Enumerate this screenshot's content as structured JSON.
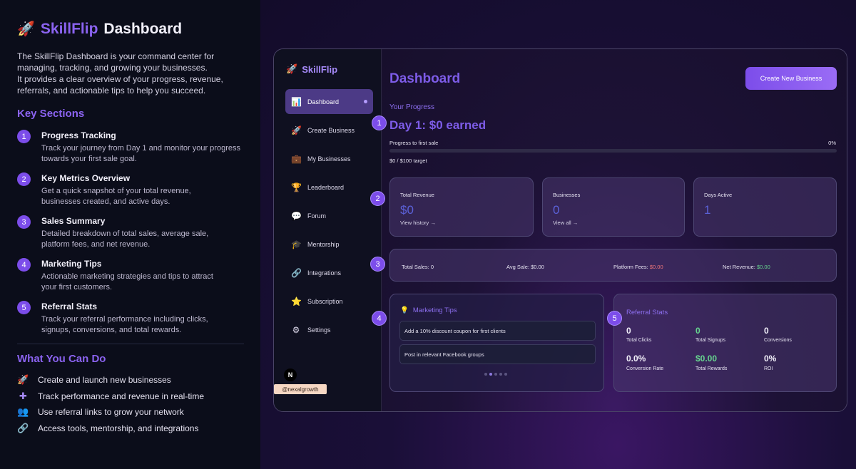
{
  "left": {
    "icon": "rocket-icon",
    "brand_accent": "SkillFlip",
    "brand_rest": "Dashboard",
    "intro_lines": [
      "The SkillFlip Dashboard is your command center for",
      "managing, tracking, and growing your businesses.",
      "It provides a clear overview of your progress, revenue,",
      "referrals, and actionable tips to help you succeed."
    ],
    "key_sections_heading": "Key Sections",
    "key_sections": [
      {
        "num": "1",
        "title": "Progress Tracking",
        "desc1": "Track your journey from Day 1 and monitor your progress",
        "desc2": "towards your first sale goal."
      },
      {
        "num": "2",
        "title": "Key Metrics Overview",
        "desc1": "Get a quick snapshot of your total revenue,",
        "desc2": "businesses created, and active days."
      },
      {
        "num": "3",
        "title": "Sales Summary",
        "desc1": "Detailed breakdown of total sales, average sale,",
        "desc2": "platform fees, and net revenue."
      },
      {
        "num": "4",
        "title": "Marketing Tips",
        "desc1": "Actionable marketing strategies and tips to attract",
        "desc2": "your first customers."
      },
      {
        "num": "5",
        "title": "Referral Stats",
        "desc1": "Track your referral performance including clicks,",
        "desc2": "signups, conversions, and total rewards."
      }
    ],
    "what_you_can_do_heading": "What You Can Do",
    "what_you_can_do": [
      {
        "icon": "rocket-icon",
        "text": "Create and launch new businesses"
      },
      {
        "icon": "chart-icon",
        "text": "Track performance and revenue in real-time"
      },
      {
        "icon": "users-icon",
        "text": "Use referral links to grow your network"
      },
      {
        "icon": "link-icon",
        "text": "Access tools, mentorship, and integrations"
      }
    ]
  },
  "app": {
    "sidebar": {
      "brand": "SkillFlip",
      "items": [
        {
          "icon": "chart-icon",
          "label": "Dashboard"
        },
        {
          "icon": "rocket-icon",
          "label": "Create Business"
        },
        {
          "icon": "briefcase-icon",
          "label": "My Businesses"
        },
        {
          "icon": "trophy-icon",
          "label": "Leaderboard"
        },
        {
          "icon": "chat-icon",
          "label": "Forum"
        },
        {
          "icon": "graduation-cap-icon",
          "label": "Mentorship"
        },
        {
          "icon": "link-icon",
          "label": "Integrations"
        },
        {
          "icon": "star-icon",
          "label": "Subscription"
        },
        {
          "icon": "gear-icon",
          "label": "Settings"
        }
      ],
      "avatar_initial": "N",
      "handle": "@nexalgrowth"
    },
    "header": {
      "title": "Dashboard",
      "create_button": "Create New Business"
    },
    "progress": {
      "label": "Your Progress",
      "headline": "Day 1: $0 earned",
      "bar_label": "Progress to first sale",
      "percent_text": "0%",
      "fraction": 0,
      "target_text": "$0 / $100 target"
    },
    "metrics": [
      {
        "label": "Total Revenue",
        "value": "$0",
        "link": "View history →"
      },
      {
        "label": "Businesses",
        "value": "0",
        "link": "View all →"
      },
      {
        "label": "Days Active",
        "value": "1",
        "link": ""
      }
    ],
    "summary": {
      "total_sales_label": "Total Sales:",
      "total_sales": "0",
      "avg_sale_label": "Avg Sale:",
      "avg_sale": "$0.00",
      "platform_fees_label": "Platform Fees:",
      "platform_fees": "$0.00",
      "net_revenue_label": "Net Revenue:",
      "net_revenue": "$0.00"
    },
    "marketing_tips": {
      "title": "Marketing Tips",
      "icon": "lightbulb-icon",
      "tips": [
        "Add a 10% discount coupon for first clients",
        "Post in relevant Facebook groups"
      ]
    },
    "referral_stats": {
      "title": "Referral Stats",
      "stats": [
        {
          "value": "0",
          "label": "Total Clicks"
        },
        {
          "value": "0",
          "label": "Total Signups"
        },
        {
          "value": "0",
          "label": "Conversions"
        },
        {
          "value": "0.0%",
          "label": "Conversion Rate"
        },
        {
          "value": "$0.00",
          "label": "Total Rewards"
        },
        {
          "value": "0%",
          "label": "ROI"
        }
      ]
    },
    "callouts": [
      "1",
      "2",
      "3",
      "4",
      "5"
    ]
  },
  "colors": {
    "accent": "#7c4dea",
    "red": "#f0767a",
    "green": "#66d58f"
  }
}
